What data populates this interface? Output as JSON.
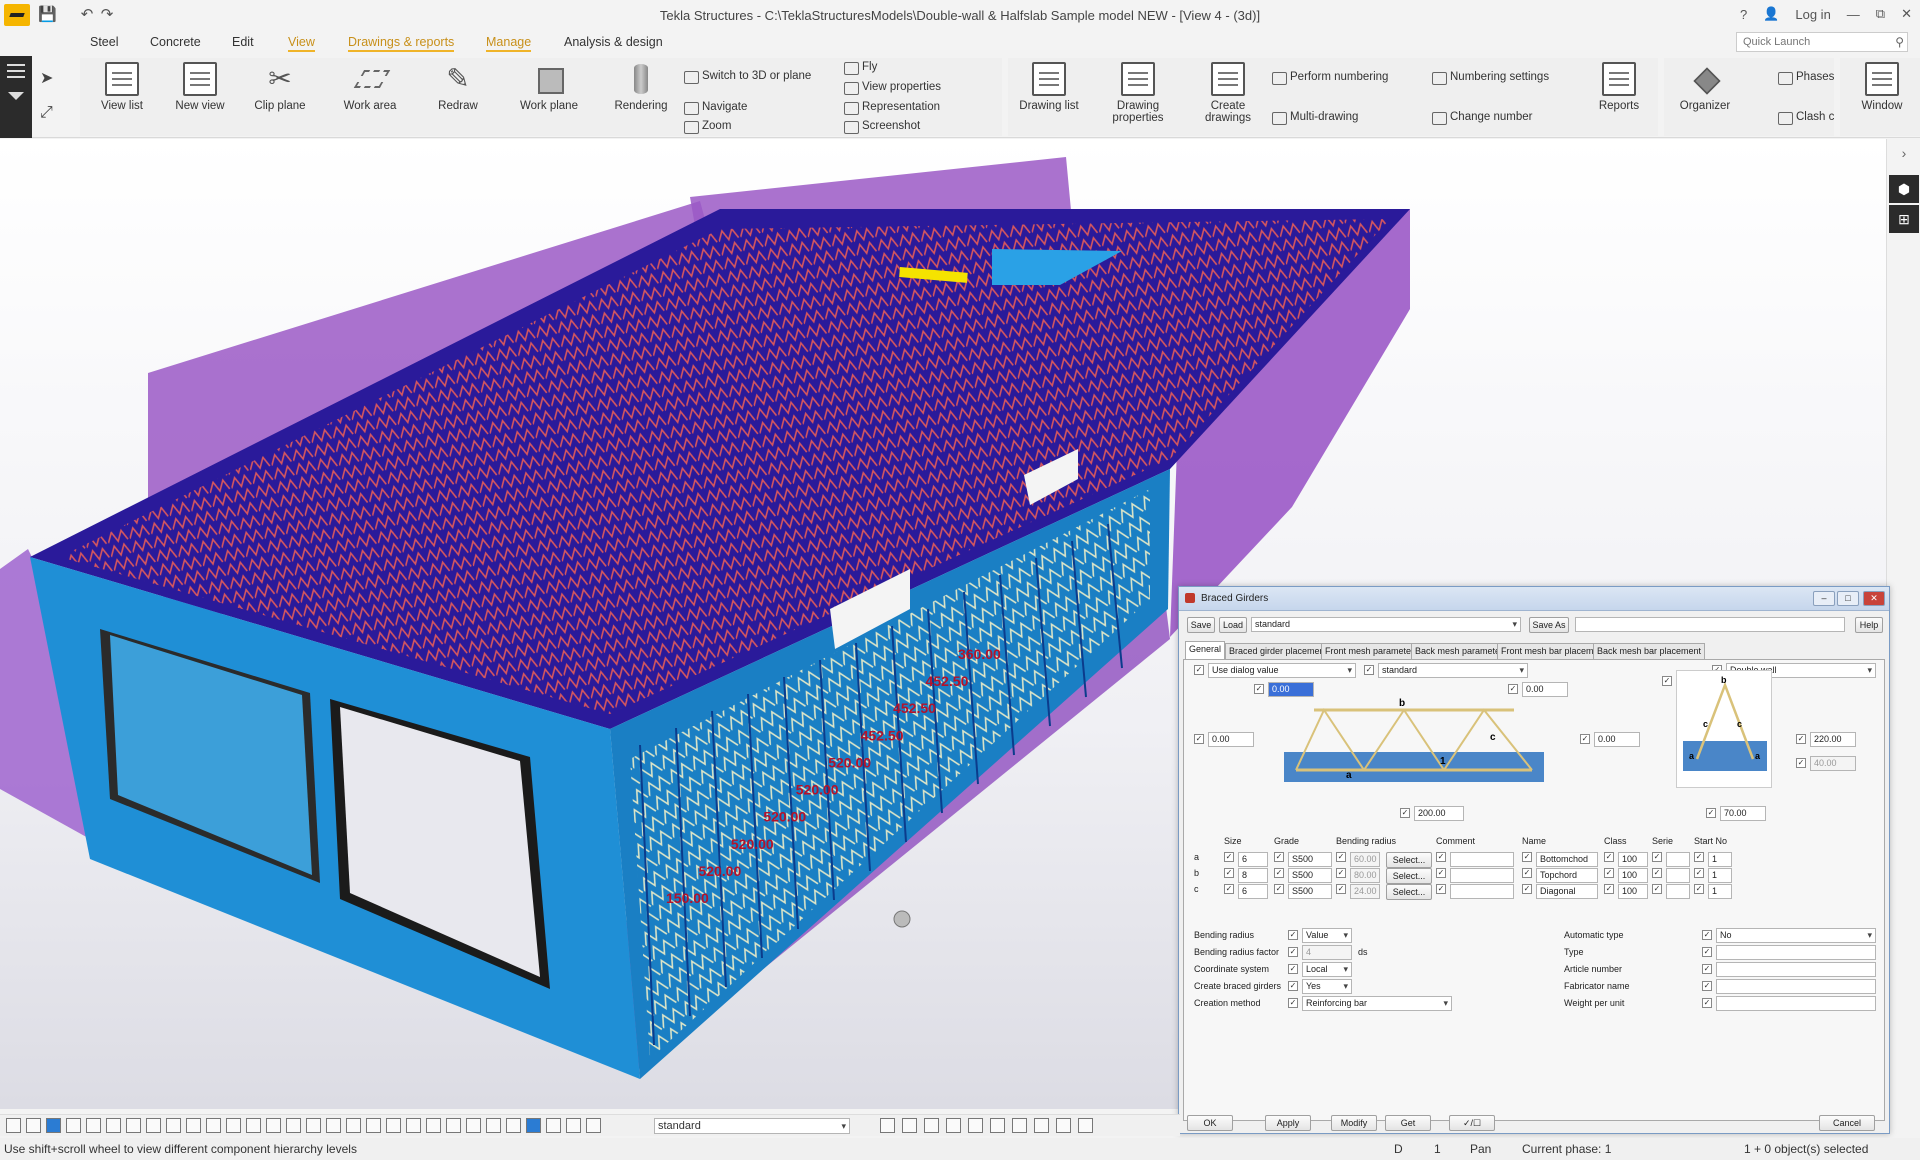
{
  "window": {
    "title": "Tekla Structures - C:\\TeklaStructuresModels\\Double-wall & Halfslab Sample model NEW - [View 4 - (3d)]",
    "help": "?",
    "login": "Log in",
    "min": "—",
    "max": "⧉",
    "close": "✕"
  },
  "menu": {
    "items": [
      "Steel",
      "Concrete",
      "Edit",
      "View",
      "Drawings & reports",
      "Manage",
      "Analysis & design"
    ],
    "active": "View",
    "quick_launch_placeholder": "Quick Launch"
  },
  "ribbon": {
    "large": [
      "View list",
      "New view",
      "Clip plane",
      "Work area",
      "Redraw",
      "Work plane",
      "Rendering"
    ],
    "view_small": [
      "Switch to 3D or plane",
      "Navigate",
      "Zoom",
      "Fly",
      "View properties",
      "Representation",
      "Screenshot"
    ],
    "drawings_large": [
      "Drawing list",
      "Drawing properties",
      "Create drawings",
      "Reports",
      "Organizer",
      "Window"
    ],
    "drawings_small": [
      "Perform numbering",
      "Multi-drawing",
      "Numbering settings",
      "Change number",
      "Phases",
      "Clash c"
    ]
  },
  "model": {
    "dimensions": [
      "360.00",
      "452.50",
      "452.50",
      "452.50",
      "520.00",
      "520.00",
      "520.00",
      "520.00",
      "520.00",
      "150.00"
    ],
    "colors": {
      "wall": "#1f8fd6",
      "slab": "#2a1a9a",
      "shell": "#9b59c6",
      "rebar": "#e05a5a",
      "girder": "#f2f0c8"
    }
  },
  "dialog": {
    "title": "Braced Girders",
    "save": "Save",
    "load": "Load",
    "load_value": "standard",
    "save_as": "Save As",
    "help": "Help",
    "tabs": [
      "General",
      "Braced girder placement",
      "Front mesh parameters",
      "Back mesh parameters",
      "Front mesh bar placement",
      "Back mesh bar placement"
    ],
    "use_dialog_value": "Use dialog value",
    "standard": "standard",
    "double_wall": "Double wall",
    "val_top": "0.00",
    "val_top2": "0.00",
    "val_left": "0.00",
    "val_right": "0.00",
    "val_bottom": "200.00",
    "val_220": "220.00",
    "val_40": "40.00",
    "val_70": "70.00",
    "fig_labels": {
      "b": "b",
      "c": "c",
      "a": "a",
      "one": "1"
    },
    "table_headers": [
      "Size",
      "Grade",
      "Bending radius",
      "Comment",
      "Name",
      "Class",
      "Serie",
      "Start No"
    ],
    "rows": [
      {
        "key": "a",
        "size": "6",
        "grade": "S500",
        "radius": "60.00",
        "select": "Select...",
        "name": "Bottomchod",
        "class": "100",
        "start": "1"
      },
      {
        "key": "b",
        "size": "8",
        "grade": "S500",
        "radius": "80.00",
        "select": "Select...",
        "name": "Topchord",
        "class": "100",
        "start": "1"
      },
      {
        "key": "c",
        "size": "6",
        "grade": "S500",
        "radius": "24.00",
        "select": "Select...",
        "name": "Diagonal",
        "class": "100",
        "start": "1"
      }
    ],
    "props_left": [
      {
        "label": "Bending radius",
        "value": "Value"
      },
      {
        "label": "Bending radius factor",
        "value": "4",
        "unit": "ds"
      },
      {
        "label": "Coordinate system",
        "value": "Local"
      },
      {
        "label": "Create braced girders",
        "value": "Yes"
      },
      {
        "label": "Creation method",
        "value": "Reinforcing bar"
      }
    ],
    "props_right": [
      {
        "label": "Automatic type",
        "value": "No"
      },
      {
        "label": "Type",
        "value": ""
      },
      {
        "label": "Article number",
        "value": ""
      },
      {
        "label": "Fabricator name",
        "value": ""
      },
      {
        "label": "Weight per unit",
        "value": ""
      }
    ],
    "buttons": {
      "ok": "OK",
      "apply": "Apply",
      "modify": "Modify",
      "get": "Get",
      "toggle": "✓/☐",
      "cancel": "Cancel"
    }
  },
  "bottom_toolbar": {
    "filter": "standard"
  },
  "status": {
    "hint": "Use shift+scroll wheel to view different component hierarchy levels",
    "d": "D",
    "one": "1",
    "mode": "Pan",
    "phase": "Current phase: 1",
    "selection": "1 + 0 object(s) selected"
  }
}
